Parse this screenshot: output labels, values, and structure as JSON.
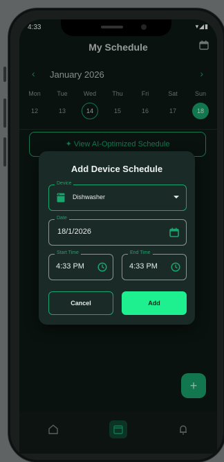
{
  "status_bar": {
    "time": "4:33",
    "icons": "▾◢▮"
  },
  "header": {
    "title": "My Schedule"
  },
  "calendar": {
    "month_label": "January 2026",
    "prev_arrow": "‹",
    "next_arrow": "›",
    "days": [
      {
        "name": "Mon",
        "date": "12"
      },
      {
        "name": "Tue",
        "date": "13"
      },
      {
        "name": "Wed",
        "date": "14"
      },
      {
        "name": "Thu",
        "date": "15"
      },
      {
        "name": "Fri",
        "date": "16"
      },
      {
        "name": "Sat",
        "date": "17"
      },
      {
        "name": "Sun",
        "date": "18"
      }
    ]
  },
  "ai_button": {
    "label": "View AI-Optimized Schedule"
  },
  "dialog": {
    "title": "Add Device Schedule",
    "device": {
      "label": "Device",
      "value": "Dishwasher"
    },
    "date": {
      "label": "Date",
      "value": "18/1/2026"
    },
    "start_time": {
      "label": "Start Time",
      "value": "4:33 PM"
    },
    "end_time": {
      "label": "End Time",
      "value": "4:33 PM"
    },
    "cancel_label": "Cancel",
    "add_label": "Add"
  },
  "fab": {
    "label": "+"
  },
  "colors": {
    "accent": "#1aa56e",
    "add_button": "#1ef08f",
    "background": "#0d1a16",
    "dialog": "#1a2a26"
  },
  "icons": [
    "calendar-icon",
    "sparkle-icon",
    "dishwasher-icon",
    "dropdown-arrow-icon",
    "clock-icon",
    "home-icon",
    "bell-icon",
    "plus-icon"
  ]
}
